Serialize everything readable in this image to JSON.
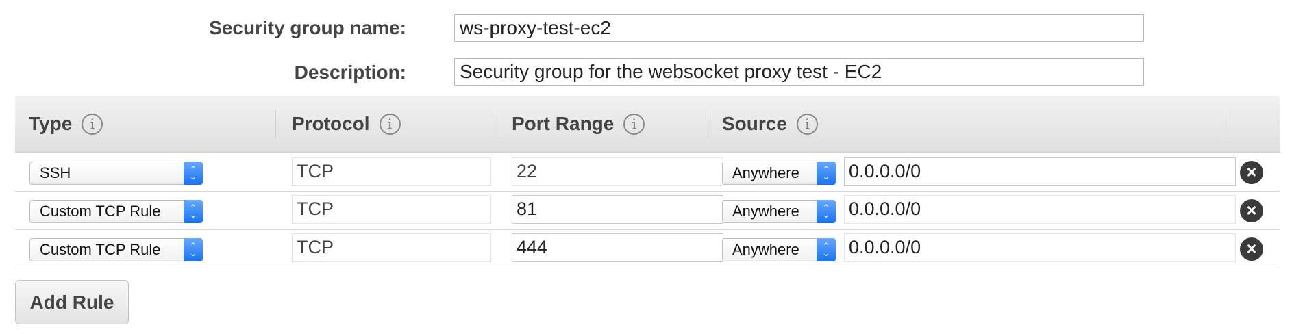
{
  "form": {
    "name_label": "Security group name:",
    "name_value": "ws-proxy-test-ec2",
    "description_label": "Description:",
    "description_value": "Security group for the websocket proxy test - EC2"
  },
  "table": {
    "headers": {
      "type": "Type",
      "protocol": "Protocol",
      "port_range": "Port Range",
      "source": "Source",
      "info_icon": "i"
    },
    "rows": [
      {
        "type": "SSH",
        "protocol": "TCP",
        "port_range": "22",
        "source_option": "Anywhere",
        "source_cidr": "0.0.0.0/0"
      },
      {
        "type": "Custom TCP Rule",
        "protocol": "TCP",
        "port_range": "81",
        "source_option": "Anywhere",
        "source_cidr": "0.0.0.0/0"
      },
      {
        "type": "Custom TCP Rule",
        "protocol": "TCP",
        "port_range": "444",
        "source_option": "Anywhere",
        "source_cidr": "0.0.0.0/0"
      }
    ]
  },
  "actions": {
    "add_rule_label": "Add Rule",
    "remove_icon": "×",
    "select_arrows_icon": "⌃⌄"
  },
  "icons": {
    "info": "info-circle-icon",
    "remove": "remove-circle-icon",
    "select": "select-arrows-icon"
  },
  "colors": {
    "select_accent": "#1773f2",
    "header_bg": "#e6e6e6",
    "remove_icon": "#3a3a3a"
  }
}
